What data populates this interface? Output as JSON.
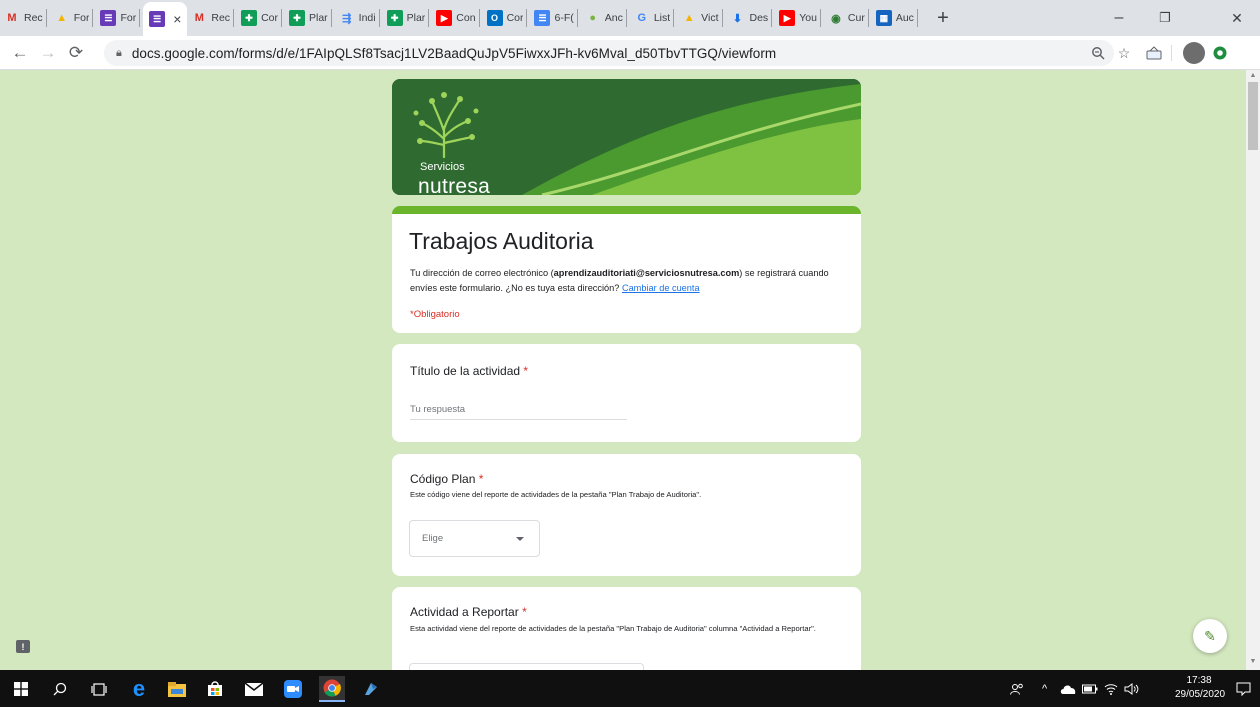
{
  "browser": {
    "tabs": [
      {
        "label": "Rec",
        "icon": "gmail-icon",
        "color": "#d93025"
      },
      {
        "label": "For",
        "icon": "drive-icon",
        "color": "#f4b400"
      },
      {
        "label": "For",
        "icon": "forms-icon",
        "color": "#673ab7"
      },
      {
        "label": "",
        "icon": "forms-icon",
        "color": "#673ab7",
        "active": true
      },
      {
        "label": "Rec",
        "icon": "gmail-icon",
        "color": "#d93025"
      },
      {
        "label": "Cor",
        "icon": "sheets-icon",
        "color": "#0f9d58"
      },
      {
        "label": "Plar",
        "icon": "sheets-icon",
        "color": "#0f9d58"
      },
      {
        "label": "Indi",
        "icon": "sitemap-icon",
        "color": "#4285f4"
      },
      {
        "label": "Plar",
        "icon": "sheets-icon",
        "color": "#0f9d58"
      },
      {
        "label": "Con",
        "icon": "youtube-icon",
        "color": "#ff0000"
      },
      {
        "label": "Cor",
        "icon": "outlook-icon",
        "color": "#0072c6"
      },
      {
        "label": "6-F(",
        "icon": "docs-icon",
        "color": "#4285f4"
      },
      {
        "label": "Anc",
        "icon": "leaf-icon",
        "color": "#7cb342"
      },
      {
        "label": "List",
        "icon": "google-icon",
        "color": "#4285f4"
      },
      {
        "label": "Vict",
        "icon": "drive-icon",
        "color": "#f4b400"
      },
      {
        "label": "Des",
        "icon": "download-icon",
        "color": "#1a73e8"
      },
      {
        "label": "You",
        "icon": "youtube-icon",
        "color": "#ff0000"
      },
      {
        "label": "Cur",
        "icon": "circle-icon",
        "color": "#2e7d32"
      },
      {
        "label": "Auc",
        "icon": "calendar-icon",
        "color": "#1565c0"
      }
    ],
    "new_tab": "+",
    "window_controls": {
      "minimize": "–",
      "maximize": "❐",
      "close": "✕"
    },
    "url": "docs.google.com/forms/d/e/1FAIpQLSf8Tsacj1LV2BaadQuJpV5FiwxxJFh-kv6Mval_d50TbvTTGQ/viewform"
  },
  "banner": {
    "brand_line1": "Servicios",
    "brand_line2": "nutresa"
  },
  "form": {
    "title": "Trabajos Auditoria",
    "email_prefix": "Tu dirección de correo electrónico (",
    "email": "aprendizauditoriati@serviciosnutresa.com",
    "email_suffix": ") se registrará cuando envíes este formulario. ¿No es tuya esta dirección?",
    "switch_account": "Cambiar de cuenta",
    "required_note": "*Obligatorio"
  },
  "questions": [
    {
      "title": "Título de la actividad",
      "required": "*",
      "placeholder": "Tu respuesta"
    },
    {
      "title": "Código Plan",
      "required": "*",
      "help": "Este código viene del reporte de actividades de la pestaña \"Plan Trabajo de Auditoria\".",
      "select_value": "Elige"
    },
    {
      "title": "Actividad a Reportar",
      "required": "*",
      "help": "Esta actividad viene del reporte de actividades de la pestaña \"Plan Trabajo de Auditoria\" columna \"Actividad a Reportar\"."
    }
  ],
  "taskbar": {
    "time": "17:38",
    "date": "29/05/2020"
  }
}
